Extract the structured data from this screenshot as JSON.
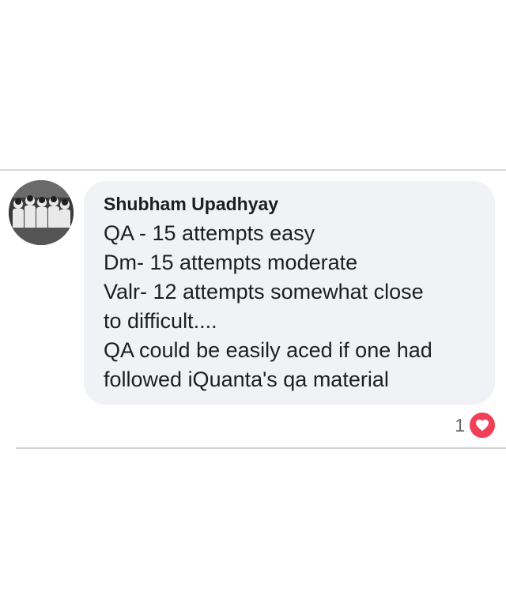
{
  "comment": {
    "author": "Shubham Upadhyay",
    "lines": [
      "QA - 15 attempts easy",
      "Dm- 15 attempts moderate",
      "Valr- 12 attempts somewhat close",
      "to difficult....",
      "QA could be easily aced if one had",
      "followed iQuanta's qa material"
    ],
    "reaction_count": "1",
    "reaction_icon": "heart-icon",
    "colors": {
      "bubble_bg": "#f0f2f5",
      "text": "#1c1e21",
      "heart": "#f33e58"
    }
  }
}
